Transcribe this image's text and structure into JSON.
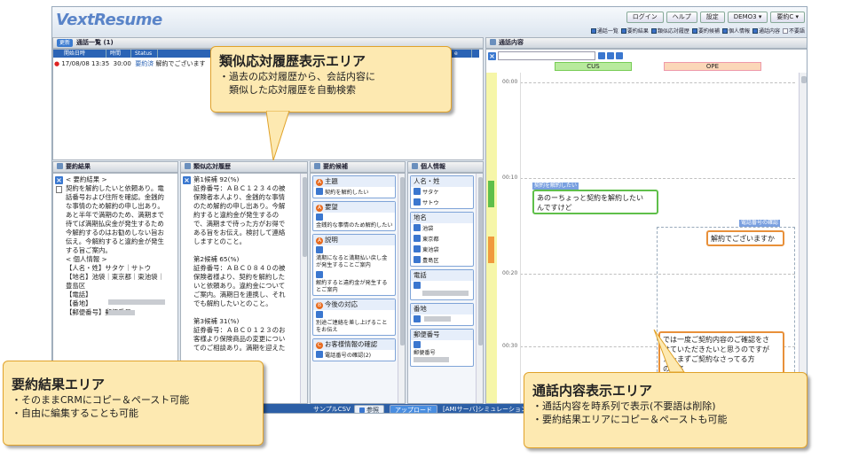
{
  "app": {
    "logo": "VextResume"
  },
  "header": {
    "buttons": [
      "ログイン",
      "ヘルプ",
      "設定",
      "DEMO3 ▾",
      "要約C ▾"
    ],
    "checkboxes": [
      {
        "label": "通話一覧",
        "checked": true
      },
      {
        "label": "要約結果",
        "checked": true
      },
      {
        "label": "類似応対履歴",
        "checked": true
      },
      {
        "label": "要約候補",
        "checked": true
      },
      {
        "label": "個人情報",
        "checked": true
      },
      {
        "label": "通話内容",
        "checked": true
      },
      {
        "label": "不要語",
        "checked": false
      }
    ]
  },
  "call_list": {
    "update_label": "更新",
    "title": "通話一覧 (1)",
    "columns": [
      "開始日時",
      "時間",
      "Status",
      "",
      "e"
    ],
    "row": {
      "start": "17/08/08 13:35",
      "duration": "30:00",
      "status": "要約済",
      "text": "解約でございます"
    }
  },
  "call_content": {
    "title": "通話内容",
    "speakers": [
      "CUS",
      "OPE"
    ],
    "times": [
      "00:00",
      "00:10",
      "00:20",
      "00:30"
    ],
    "bubbles": [
      {
        "tag": "契約を解約したい",
        "text": "あのーちょっと契約を解約したい\nんですけど"
      },
      {
        "tag": "電話番号の確認",
        "text": "解約でございますか"
      },
      {
        "tag": "",
        "text": "では一度ご契約内容のご確認をさ\nせていただきたいと思うのですが\nえーまずご契約なさってる方\nのお名"
      }
    ]
  },
  "summary": {
    "title": "要約結果",
    "text": "< 要約結果 >\n契約を解約したいと依頼あり。電\n話番号および住所を確認。金銭的\nな事情のため解約の申し出あり。\nあと半年で満期のため、満期まで\n待てば満期払戻金が発生するため\n今解約するのはお勧めしない旨お\n伝え。今解約すると違約金が発生\nする旨ご案内。\n< 個人情報 >\n【人名・姓】サタケ｜サトウ\n【地名】池袋｜東京都｜東池袋｜\n豊島区\n【電話】\n【番地】\n【郵便番号】郵便番号"
  },
  "history": {
    "title": "類似応対履歴",
    "text": "第1候補 92(%)\n証券番号：ＡＢＣ１２３４の被\n保険者本人より、金銭的な事情\nのため解約の申し出あり。今解\n約すると違約金が発生するの\nで、満期まで待った方がお得で\nある旨をお伝え。検討して連絡\nしますとのこと。\n\n第2候補 65(%)\n証券番号：ＡＢＣ０８４０の被\n保険者様より、契約を解約した\nいと依頼あり。違約金について\nご案内。満期日を連携し、それ\nでも解約したいとのこと。\n\n第3候補 31(%)\n証券番号：ＡＢＣ０１２３のお\n客様より保険商品の変更につい\nてのご相談あり。満期を迎えた"
  },
  "candidates": {
    "title": "要約候補",
    "groups": [
      {
        "num": "A",
        "name": "主題",
        "items": [
          "契約を解約したい"
        ]
      },
      {
        "num": "A",
        "name": "要望",
        "items": [
          "金銭的な事情のため解約したい"
        ]
      },
      {
        "num": "A",
        "name": "説明",
        "items": [
          "満期になると満期払い戻し金\nが発生することご案内",
          "解約すると違約金が発生する\nとご案内"
        ]
      },
      {
        "num": "B",
        "name": "今後の対応",
        "items": [
          "別途ご連絡を差し上げること\nをお伝え"
        ]
      },
      {
        "num": "C",
        "name": "お客様情報の確認",
        "items": [
          "電話番号の確認(2)"
        ]
      }
    ]
  },
  "personal": {
    "title": "個人情報",
    "groups": [
      {
        "name": "人名・姓",
        "items": [
          "サタケ",
          "サトウ"
        ]
      },
      {
        "name": "地名",
        "items": [
          "池袋",
          "東京都",
          "東池袋",
          "豊島区"
        ]
      },
      {
        "name": "電話",
        "items": [
          ""
        ]
      },
      {
        "name": "番地",
        "items": [
          ""
        ]
      },
      {
        "name": "郵便番号",
        "items": [
          "郵便番号"
        ]
      }
    ]
  },
  "footer": {
    "csv_label": "サンプルCSV",
    "ref_button": "参照",
    "upload_button": "アップロード",
    "ami_text": "[AMIサーバ]シミュレーション"
  },
  "callouts": {
    "history": {
      "title": "類似応対履歴表示エリア",
      "lines": [
        "・過去の応対履歴から、会話内容に",
        "　類似した応対履歴を自動検索"
      ]
    },
    "summary": {
      "title": "要約結果エリア",
      "lines": [
        "・そのままCRMにコピー＆ペースト可能",
        "・自由に編集することも可能"
      ]
    },
    "content": {
      "title": "通話内容表示エリア",
      "lines": [
        "・通話内容を時系列で表示(不要語は削除)",
        "・要約結果エリアにコピー＆ペーストも可能"
      ]
    }
  },
  "colors": {
    "accent": "#2a63b5",
    "callout_bg": "#fde9b1",
    "bubble_cus": "#5fbf4a",
    "bubble_ope": "#e8903a"
  }
}
